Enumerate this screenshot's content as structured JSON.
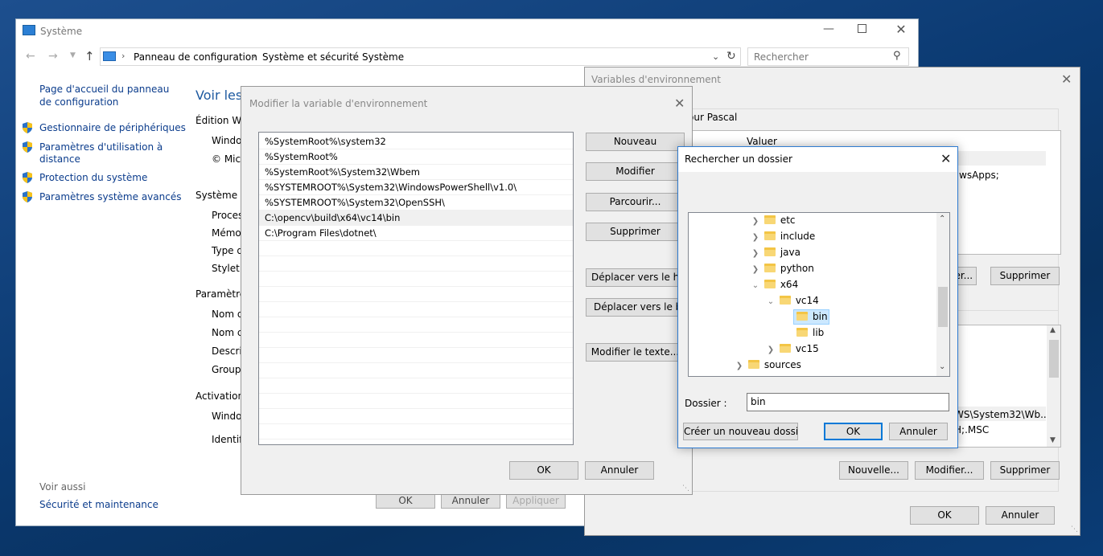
{
  "system_window": {
    "title": "Système",
    "breadcrumb": [
      "Panneau de configuration",
      "Système et sécurité",
      "Système"
    ],
    "search_placeholder": "Rechercher",
    "sidebar": {
      "home_link": "Page d'accueil du panneau de configuration",
      "items": [
        "Gestionnaire de périphériques",
        "Paramètres d'utilisation à distance",
        "Protection du système",
        "Paramètres système avancés"
      ],
      "see_also_label": "Voir aussi",
      "see_also_link": "Sécurité et maintenance"
    },
    "main": {
      "heading": "Voir les",
      "section_edition": "Édition Wi",
      "edition_lines": [
        "Window",
        "© Micr"
      ],
      "section_system": "Système",
      "system_lines": [
        "Process",
        "Mémoi",
        "Type d",
        "Stylet e"
      ],
      "section_params": "Paramètres",
      "params_lines": [
        "Nom d",
        "Nom c",
        "Descrip",
        "Groupe"
      ],
      "section_activation": "Activation",
      "activation_lines": [
        "Window",
        "Identifi"
      ]
    },
    "hidden_buttons": {
      "ok": "OK",
      "cancel": "Annuler",
      "apply": "Appliquer"
    }
  },
  "env_window": {
    "title": "Variables d'environnement",
    "user_section_label": "our Pascal",
    "value_header": "Valuer",
    "value_fragment": "wsApps;",
    "mid_button": "fier...",
    "delete_label": "Supprimer",
    "sys_fragments": [
      "WS\\System32\\Wb...",
      "H;.MSC"
    ],
    "new_label": "Nouvelle...",
    "modify_label": "Modifier...",
    "ok_label": "OK",
    "cancel_label": "Annuler"
  },
  "edit_window": {
    "title": "Modifier la variable d'environnement",
    "paths": [
      "%SystemRoot%\\system32",
      "%SystemRoot%",
      "%SystemRoot%\\System32\\Wbem",
      "%SYSTEMROOT%\\System32\\WindowsPowerShell\\v1.0\\",
      "%SYSTEMROOT%\\System32\\OpenSSH\\",
      "C:\\opencv\\build\\x64\\vc14\\bin",
      "C:\\Program Files\\dotnet\\"
    ],
    "buttons": {
      "new": "Nouveau",
      "modify": "Modifier",
      "browse": "Parcourir...",
      "delete": "Supprimer",
      "move_up": "Déplacer vers le haut",
      "move_down": "Déplacer vers le bas",
      "edit_text": "Modifier le texte...",
      "ok": "OK",
      "cancel": "Annuler"
    }
  },
  "browse_window": {
    "title": "Rechercher un dossier",
    "tree": {
      "etc": "etc",
      "include": "include",
      "java": "java",
      "python": "python",
      "x64": "x64",
      "vc14": "vc14",
      "bin": "bin",
      "lib": "lib",
      "vc15": "vc15",
      "sources": "sources"
    },
    "folder_label": "Dossier :",
    "folder_value": "bin",
    "new_folder_button": "Créer un nouveau dossier",
    "ok": "OK",
    "cancel": "Annuler"
  },
  "colors": {
    "accent": "#0078d7",
    "link": "#0b3c8c",
    "selection": "#cce8ff",
    "folder": "#f8d775"
  }
}
